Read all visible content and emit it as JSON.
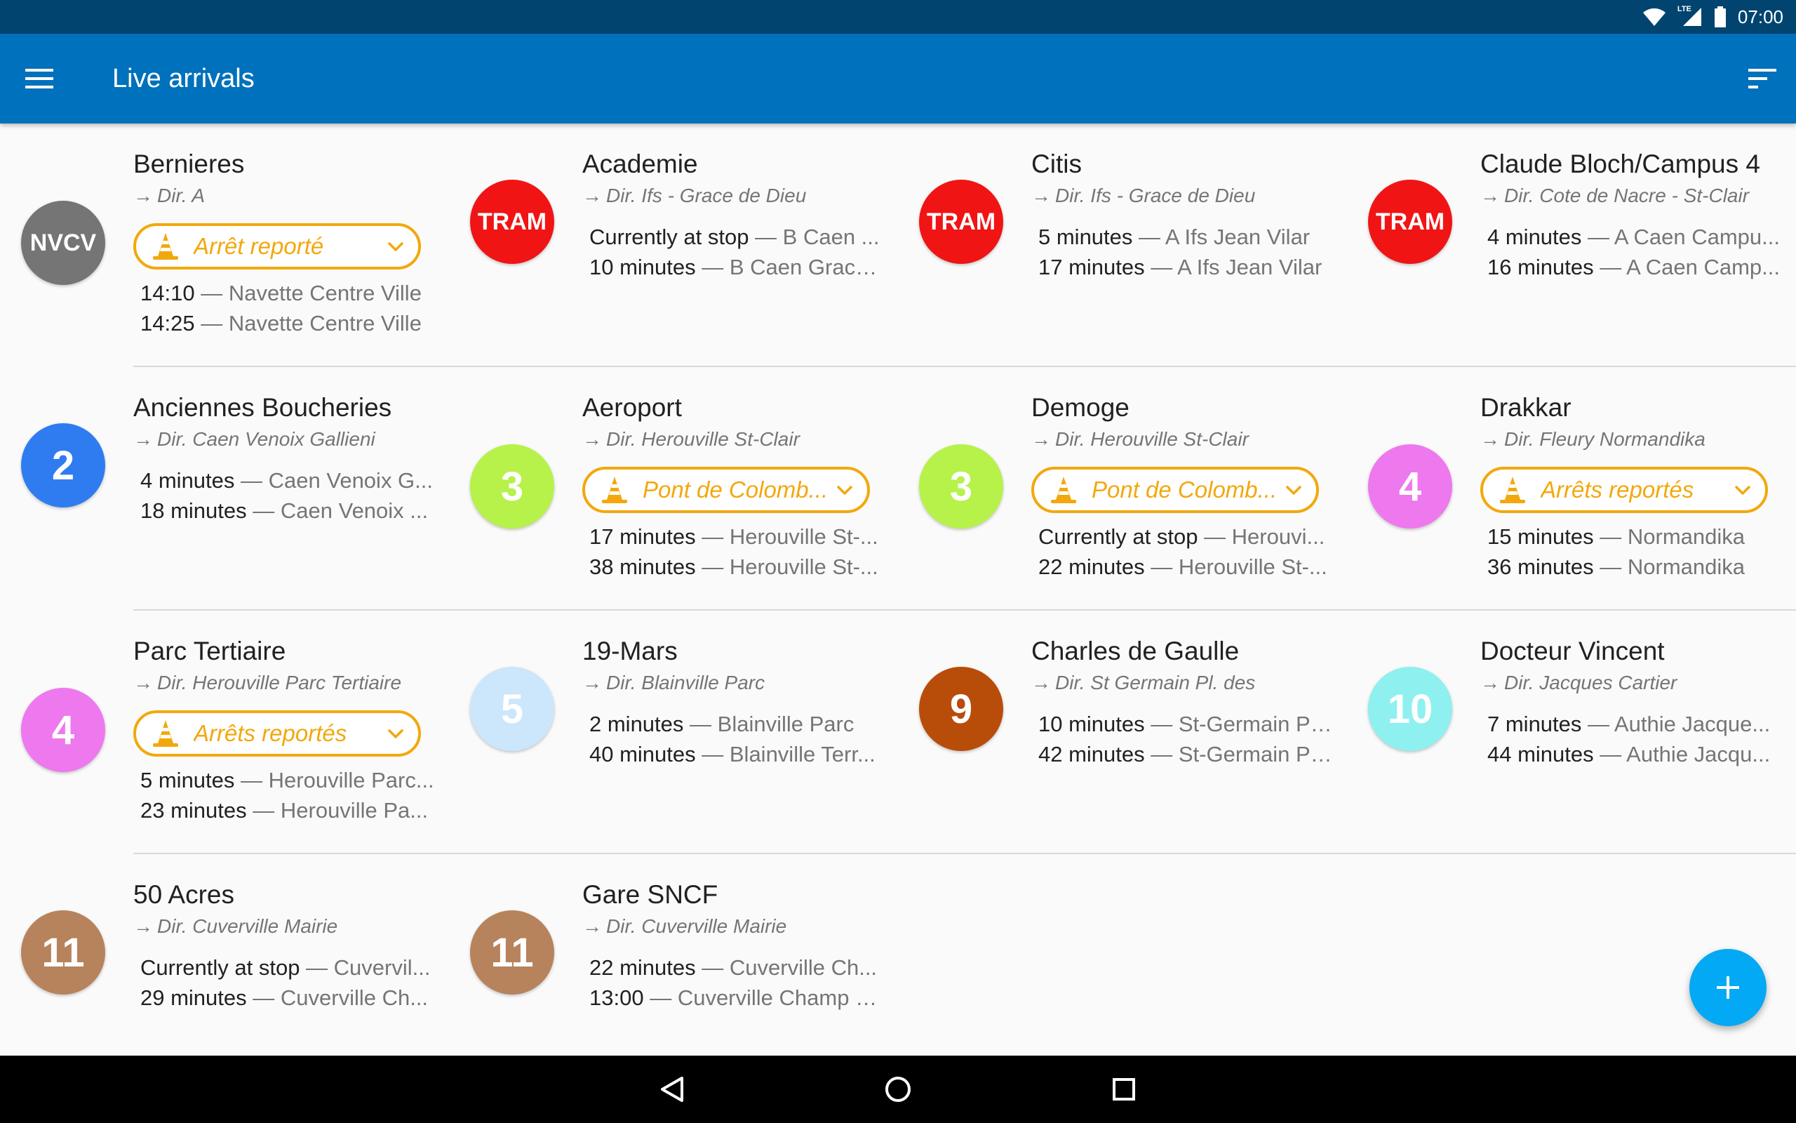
{
  "status_bar": {
    "time": "07:00",
    "network": "LTE",
    "icons": [
      "wifi-icon",
      "signal-icon",
      "battery-icon"
    ]
  },
  "app_bar": {
    "title": "Live arrivals",
    "menu_icon": "menu-icon",
    "sort_icon": "sort-icon"
  },
  "colors": {
    "app_bar": "#0071bc",
    "status_bar": "#00446f",
    "alert": "#f2a80d",
    "fab": "#03a9f4"
  },
  "cards": [
    {
      "badge": "NVCV",
      "badge_color": "#757575",
      "badge_size": "small",
      "name": "Bernieres",
      "direction": "Dir. A",
      "alert": "Arrêt reporté",
      "departures": [
        {
          "time": "14:10",
          "dest": "Navette Centre Ville"
        },
        {
          "time": "14:25",
          "dest": "Navette Centre Ville"
        }
      ]
    },
    {
      "badge": "TRAM",
      "badge_color": "#f01414",
      "badge_size": "tram",
      "name": "Academie",
      "direction": "Dir. Ifs - Grace de Dieu",
      "alert": null,
      "departures": [
        {
          "time": "Currently at stop",
          "dest": "B Caen ..."
        },
        {
          "time": "10 minutes",
          "dest": "B Caen Grace..."
        }
      ]
    },
    {
      "badge": "TRAM",
      "badge_color": "#f01414",
      "badge_size": "tram",
      "name": "Citis",
      "direction": "Dir. Ifs - Grace de Dieu",
      "alert": null,
      "departures": [
        {
          "time": "5 minutes",
          "dest": "A Ifs Jean Vilar"
        },
        {
          "time": "17 minutes",
          "dest": "A Ifs Jean Vilar"
        }
      ]
    },
    {
      "badge": "TRAM",
      "badge_color": "#f01414",
      "badge_size": "tram",
      "name": "Claude Bloch/Campus 4",
      "direction": "Dir. Cote de Nacre - St-Clair",
      "alert": null,
      "departures": [
        {
          "time": "4 minutes",
          "dest": "A Caen Campu..."
        },
        {
          "time": "16 minutes",
          "dest": "A Caen Camp..."
        }
      ]
    },
    {
      "badge": "2",
      "badge_color": "#2f7cf0",
      "badge_size": "large",
      "name": "Anciennes Boucheries",
      "direction": "Dir. Caen Venoix Gallieni",
      "alert": null,
      "departures": [
        {
          "time": "4 minutes",
          "dest": "Caen Venoix G..."
        },
        {
          "time": "18 minutes",
          "dest": "Caen Venoix ..."
        }
      ]
    },
    {
      "badge": "3",
      "badge_color": "#b6f24a",
      "badge_size": "large",
      "name": "Aeroport",
      "direction": "Dir. Herouville St-Clair",
      "alert": "Pont de Colomb...",
      "departures": [
        {
          "time": "17 minutes",
          "dest": "Herouville St-..."
        },
        {
          "time": "38 minutes",
          "dest": "Herouville St-..."
        }
      ]
    },
    {
      "badge": "3",
      "badge_color": "#b6f24a",
      "badge_size": "large",
      "name": "Demoge",
      "direction": "Dir. Herouville St-Clair",
      "alert": "Pont de Colomb...",
      "departures": [
        {
          "time": "Currently at stop",
          "dest": "Herouvi..."
        },
        {
          "time": "22 minutes",
          "dest": "Herouville St-..."
        }
      ]
    },
    {
      "badge": "4",
      "badge_color": "#ee78ee",
      "badge_size": "large",
      "name": "Drakkar",
      "direction": "Dir. Fleury Normandika",
      "alert": "Arrêts reportés",
      "departures": [
        {
          "time": "15 minutes",
          "dest": "Normandika"
        },
        {
          "time": "36 minutes",
          "dest": "Normandika"
        }
      ]
    },
    {
      "badge": "4",
      "badge_color": "#ee78ee",
      "badge_size": "large",
      "name": "Parc Tertiaire",
      "direction": "Dir. Herouville Parc Tertiaire",
      "alert": "Arrêts reportés",
      "departures": [
        {
          "time": "5 minutes",
          "dest": "Herouville Parc..."
        },
        {
          "time": "23 minutes",
          "dest": "Herouville Pa..."
        }
      ]
    },
    {
      "badge": "5",
      "badge_color": "#cce6fb",
      "badge_size": "large",
      "name": "19-Mars",
      "direction": "Dir. Blainville Parc",
      "alert": null,
      "departures": [
        {
          "time": "2 minutes",
          "dest": "Blainville Parc"
        },
        {
          "time": "40 minutes",
          "dest": "Blainville Terr..."
        }
      ]
    },
    {
      "badge": "9",
      "badge_color": "#b84d0a",
      "badge_size": "large",
      "name": "Charles de Gaulle",
      "direction": "Dir. St Germain Pl. des",
      "alert": null,
      "departures": [
        {
          "time": "10 minutes",
          "dest": "St-Germain Pl..."
        },
        {
          "time": "42 minutes",
          "dest": "St-Germain Pl..."
        }
      ]
    },
    {
      "badge": "10",
      "badge_color": "#8ff0f0",
      "badge_size": "large",
      "name": "Docteur Vincent",
      "direction": "Dir. Jacques Cartier",
      "alert": null,
      "departures": [
        {
          "time": "7 minutes",
          "dest": "Authie Jacque..."
        },
        {
          "time": "44 minutes",
          "dest": "Authie Jacqu..."
        }
      ]
    },
    {
      "badge": "11",
      "badge_color": "#b7835c",
      "badge_size": "large",
      "name": "50 Acres",
      "direction": "Dir. Cuverville Mairie",
      "alert": null,
      "departures": [
        {
          "time": "Currently at stop",
          "dest": "Cuvervil..."
        },
        {
          "time": "29 minutes",
          "dest": "Cuverville Ch..."
        }
      ]
    },
    {
      "badge": "11",
      "badge_color": "#b7835c",
      "badge_size": "large",
      "name": "Gare SNCF",
      "direction": "Dir. Cuverville Mairie",
      "alert": null,
      "departures": [
        {
          "time": "22 minutes",
          "dest": "Cuverville Ch..."
        },
        {
          "time": "13:00",
          "dest": "Cuverville Champ P..."
        }
      ]
    }
  ],
  "fab": {
    "icon": "plus-icon"
  },
  "nav_bar": {
    "icons": [
      "back-icon",
      "home-icon",
      "recents-icon"
    ]
  }
}
